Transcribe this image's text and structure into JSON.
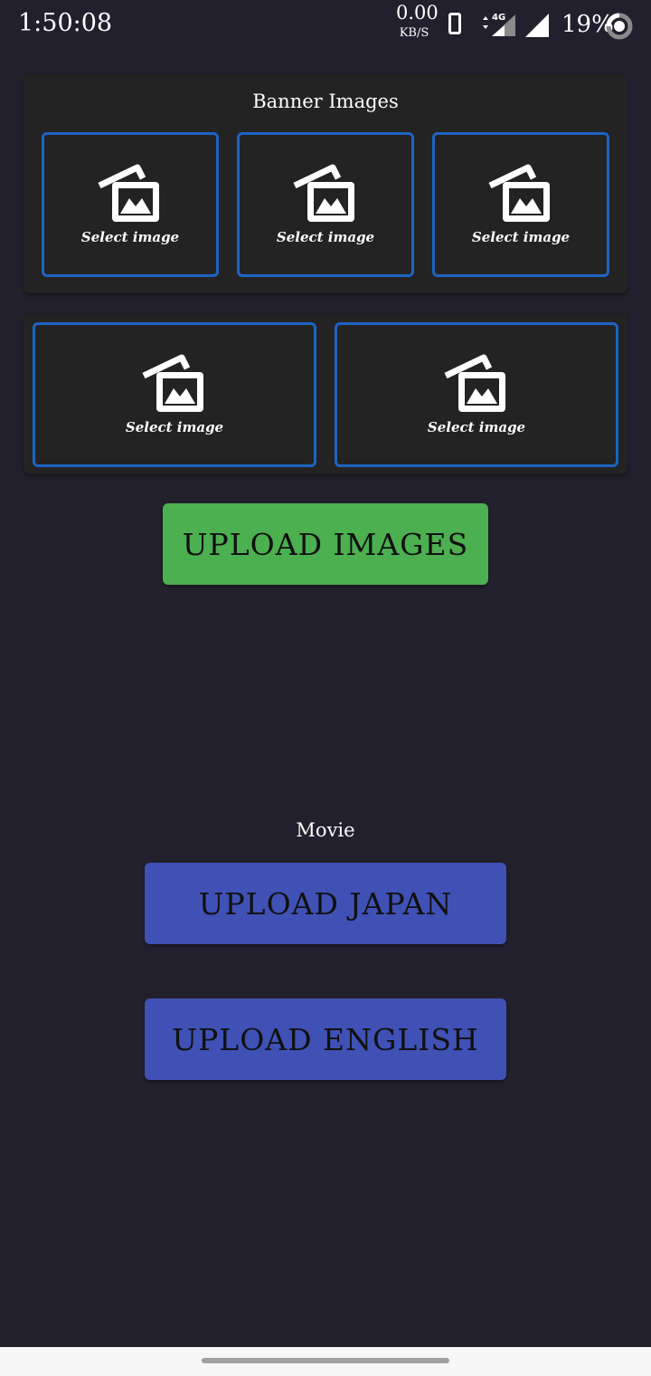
{
  "status_bar": {
    "time": "1:50:08",
    "net_speed": "0.00",
    "net_unit": "KB/S",
    "network": "4G",
    "battery": "19%"
  },
  "banner": {
    "title": "Banner Images",
    "slots": [
      {
        "label": "Select image"
      },
      {
        "label": "Select image"
      },
      {
        "label": "Select image"
      },
      {
        "label": "Select image"
      },
      {
        "label": "Select image"
      }
    ]
  },
  "actions": {
    "upload_images": "UPLOAD IMAGES"
  },
  "movie": {
    "title": "Movie",
    "upload_japan": "UPLOAD JAPAN",
    "upload_english": "UPLOAD ENGLISH"
  },
  "colors": {
    "background": "#22202d",
    "card": "#232323",
    "slot_border": "#1d64c2",
    "green_button": "#4caf50",
    "blue_button": "#3f51b5"
  },
  "icons": [
    "phone-icon",
    "signal-4g-icon",
    "signal-icon",
    "battery-icon",
    "image-icon"
  ]
}
